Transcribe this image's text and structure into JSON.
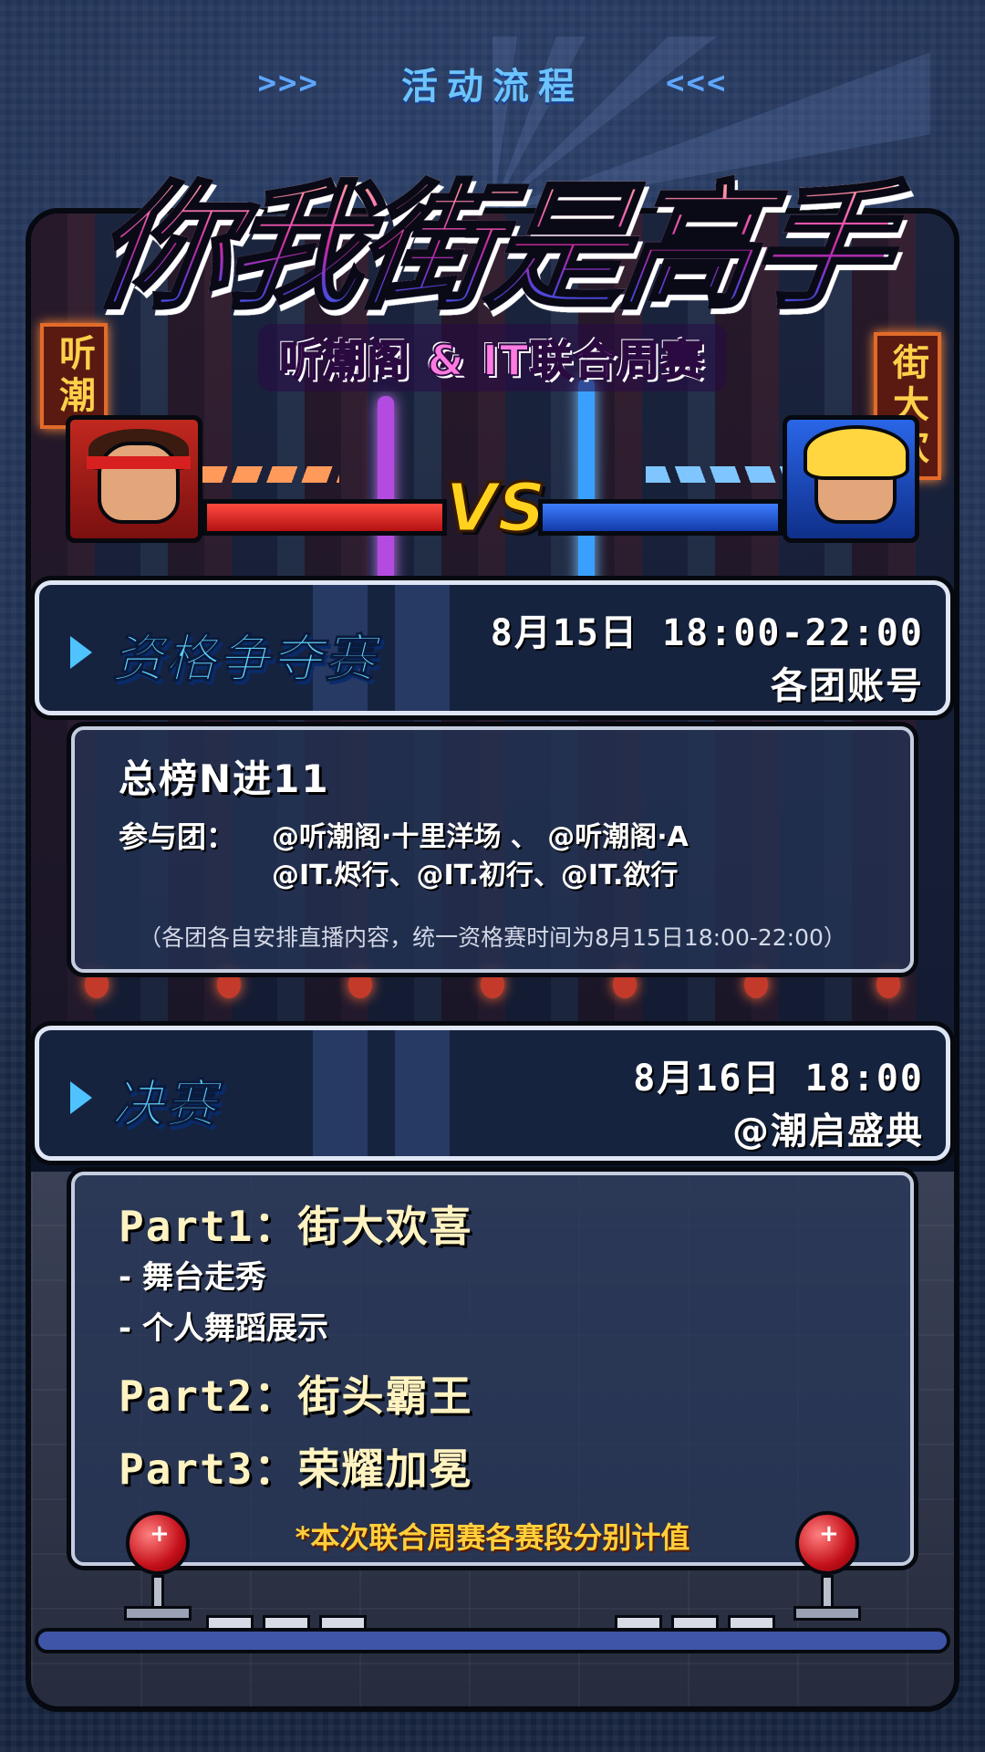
{
  "header": {
    "arrows_left": ">>>",
    "title": "活动流程",
    "arrows_right": "<<<"
  },
  "hero": {
    "title": "你我街是高手",
    "subtitle": "听潮阁 & IT联合周赛",
    "vs": "VS",
    "sign_left": "听潮",
    "sign_right": "街大欢"
  },
  "qualifier": {
    "label": "资格争夺赛",
    "date": "8月15日 18:00-22:00",
    "venue": "各团账号",
    "headline": "总榜N进11",
    "participants_label": "参与团：",
    "participants_line1": "@听潮阁·十里洋场 、 @听潮阁·A",
    "participants_line2": "@IT.烬行、@IT.初行、@IT.欲行",
    "note": "（各团各自安排直播内容，统一资格赛时间为8月15日18:00-22:00）"
  },
  "final": {
    "label": "决赛",
    "date": "8月16日 18:00",
    "venue": "@潮启盛典",
    "parts": [
      {
        "name": "Part1",
        "sep": "：",
        "title": "街大欢喜"
      },
      {
        "name": "Part2",
        "sep": "：",
        "title": "街头霸王"
      },
      {
        "name": "Part3",
        "sep": "：",
        "title": "荣耀加冕"
      }
    ],
    "part1_items": [
      "- 舞台走秀",
      "- 个人舞蹈展示"
    ],
    "note": "*本次联合周赛各赛段分别计值"
  },
  "colors": {
    "accent_blue": "#5fd0ff",
    "accent_yellow": "#ffcf3a",
    "hp_red": "#ff4a40",
    "hp_blue": "#3d7dff"
  }
}
